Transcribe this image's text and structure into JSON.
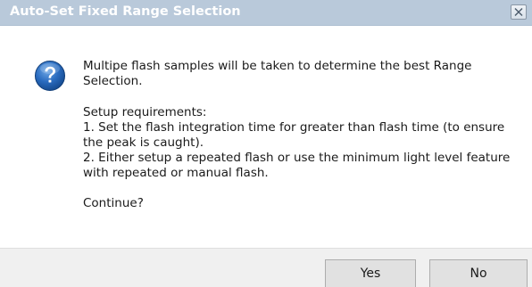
{
  "window": {
    "title": "Auto-Set Fixed Range Selection",
    "close_label": "×"
  },
  "icon": {
    "name": "question-icon",
    "color": "#1e5a9e"
  },
  "message": {
    "intro_line1": "Multipe flash samples will be taken to determine the best Range",
    "intro_line2": "Selection.",
    "requirements_heading": "Setup requirements:",
    "req1_line1": "1. Set the flash integration time for greater than flash time (to ensure",
    "req1_line2": "the peak is caught).",
    "req2_line1": "2. Either setup a repeated flash or use the minimum light level feature",
    "req2_line2": "with repeated or manual flash.",
    "question": "Continue?"
  },
  "buttons": {
    "yes_label": "Yes",
    "no_label": "No"
  }
}
